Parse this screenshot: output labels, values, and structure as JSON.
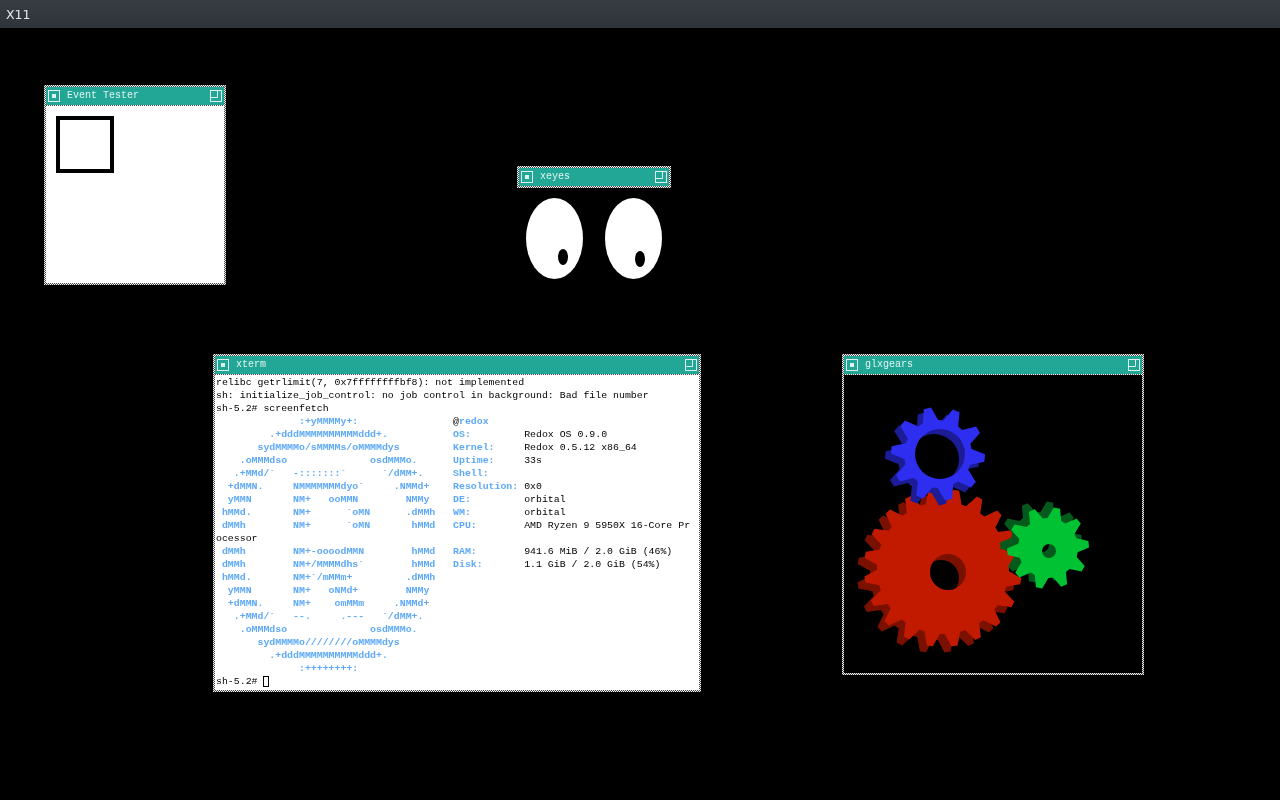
{
  "top_bar": {
    "title": "X11"
  },
  "windows": [
    {
      "kind": "event_tester",
      "title": "Event Tester"
    },
    {
      "kind": "xeyes",
      "title": "xeyes"
    },
    {
      "kind": "xterm",
      "title": "xterm",
      "lines": [
        {
          "kind": "text",
          "text": "relibc getrlimit(7, 0x7ffffffffbf8): not implemented"
        },
        {
          "kind": "text",
          "text": "sh: initialize_job_control: no job control in background: Bad file number"
        },
        {
          "kind": "text",
          "text": "sh-5.2# screenfetch"
        },
        {
          "kind": "host",
          "logo": "              :+yMMMMy+:",
          "separator": "@",
          "host": "redox"
        },
        {
          "kind": "field",
          "logo": "         .+dddMMMMMMMMMMddd+.",
          "label": "OS:",
          "value": "Redox OS 0.9.0"
        },
        {
          "kind": "field",
          "logo": "       sydMMMMo/sMMMMs/oMMMMdys",
          "label": "Kernel:",
          "value": "Redox 0.5.12 x86_64"
        },
        {
          "kind": "field",
          "logo": "    .oMMMdso              osdMMMo.",
          "label": "Uptime:",
          "value": "33s"
        },
        {
          "kind": "field",
          "logo": "   .+MMd/`   -:::::::`      `/dMM+.",
          "label": "Shell:"
        },
        {
          "kind": "field",
          "logo": "  +dMMN.     NMMMMMMMdyo`     .NMMd+",
          "label": "Resolution:",
          "value": "0x0"
        },
        {
          "kind": "field",
          "logo": "  yMMN       NM+   ooMMN        NMMy",
          "label": "DE:",
          "value": "orbital"
        },
        {
          "kind": "field",
          "logo": " hMMd.       NM+      `oMN      .dMMh",
          "label": "WM:",
          "value": "orbital"
        },
        {
          "kind": "field",
          "logo": " dMMh        NM+      `oMN       hMMd",
          "label": "CPU:",
          "value": "AMD Ryzen 9 5950X 16-Core Pr"
        },
        {
          "kind": "text",
          "text": "ocessor"
        },
        {
          "kind": "field",
          "logo": " dMMh        NM+-oooodMMN        hMMd",
          "label": "RAM:",
          "value": "941.6 MiB / 2.0 GiB (46%)"
        },
        {
          "kind": "field",
          "logo": " dMMh        NM+/MMMMdhs`        hMMd",
          "label": "Disk:",
          "value": "1.1 GiB / 2.0 GiB (54%)"
        },
        {
          "kind": "field",
          "logo": " hMMd.       NM+`/mMMm+         .dMMh"
        },
        {
          "kind": "field",
          "logo": "  yMMN       NM+   oNMd+        NMMy"
        },
        {
          "kind": "field",
          "logo": "  +dMMN.     NM+    omMMm     .NMMd+"
        },
        {
          "kind": "field",
          "logo": "   .+MMd/`   --.     .---   `/dMM+."
        },
        {
          "kind": "field",
          "logo": "    .oMMMdso              osdMMMo."
        },
        {
          "kind": "field",
          "logo": "       sydMMMMo////////oMMMMdys"
        },
        {
          "kind": "field",
          "logo": "         .+dddMMMMMMMMMMddd+."
        },
        {
          "kind": "field",
          "logo": "              :++++++++:"
        },
        {
          "kind": "prompt",
          "text": "sh-5.2#"
        }
      ]
    },
    {
      "kind": "glxgears",
      "title": "glxgears"
    }
  ]
}
